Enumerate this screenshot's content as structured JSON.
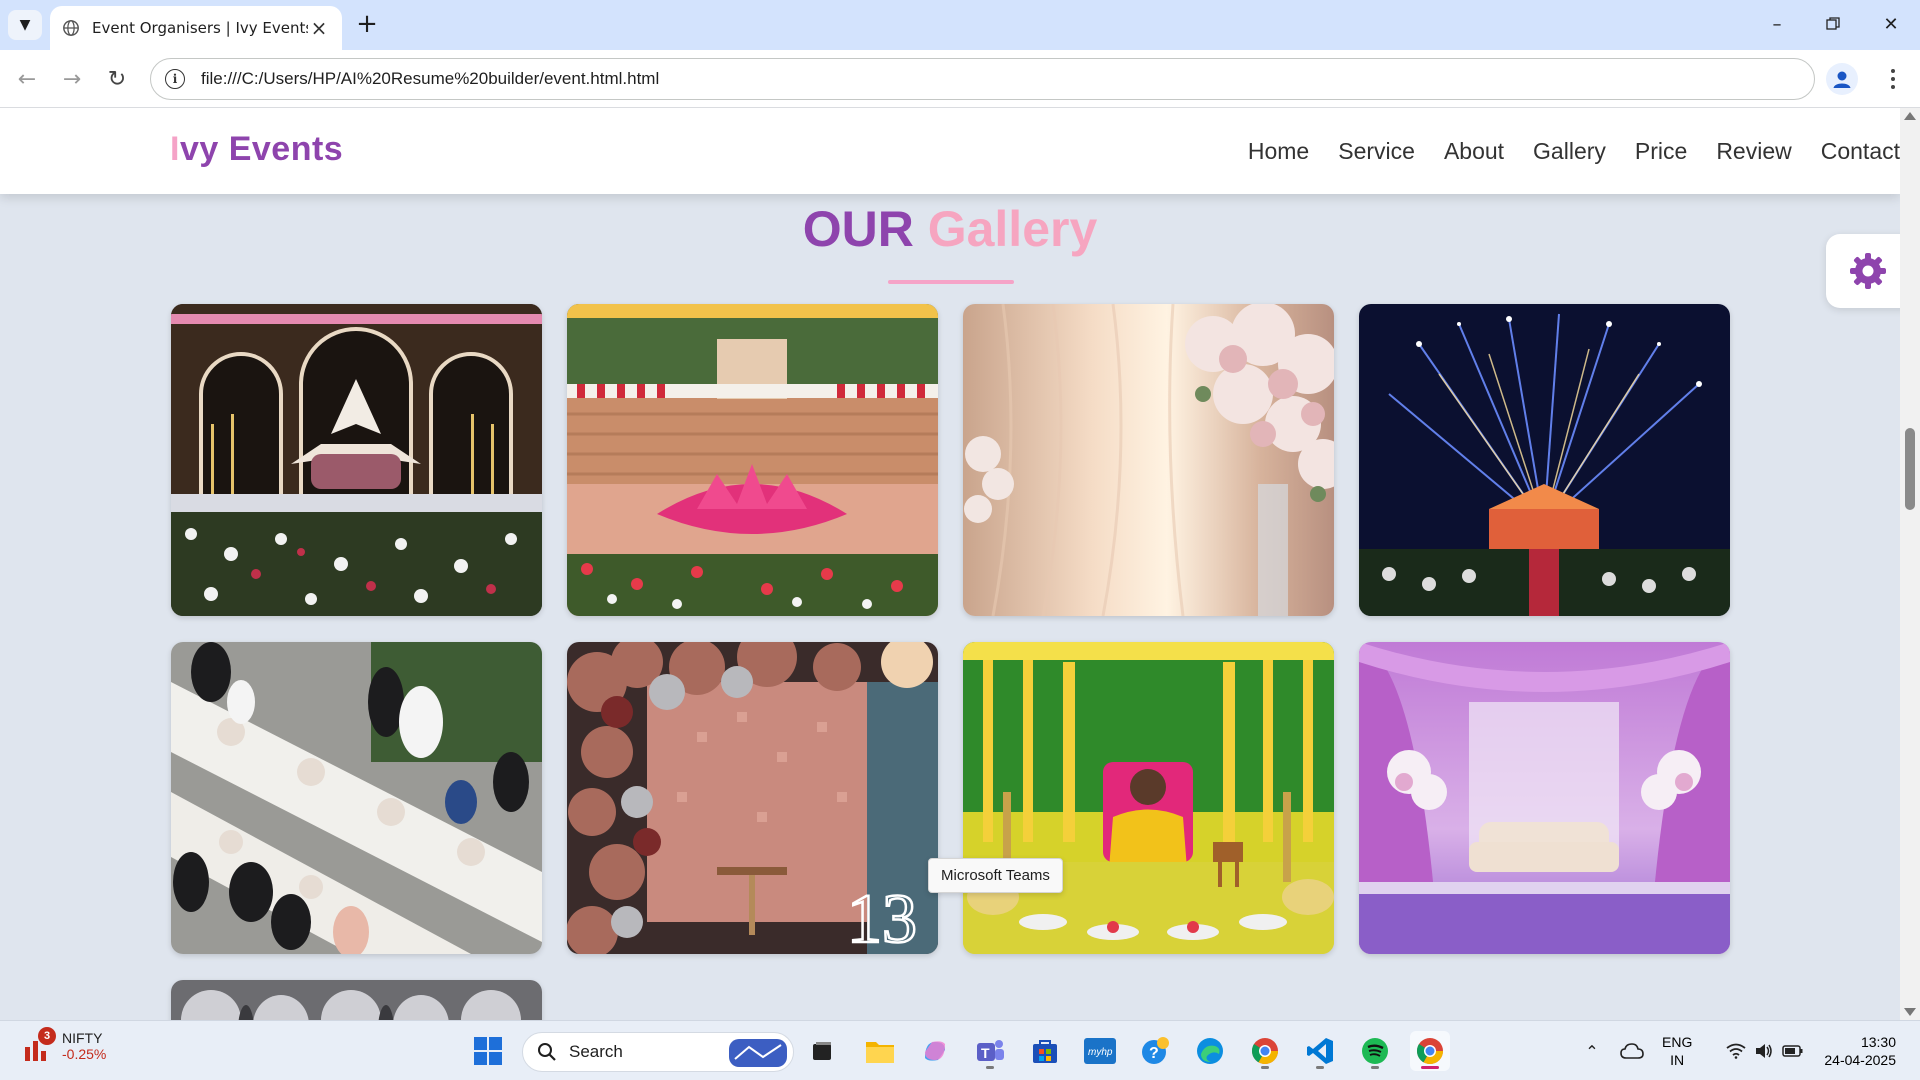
{
  "browser": {
    "tab_title": "Event Organisers | Ivy Events",
    "url": "file:///C:/Users/HP/AI%20Resume%20builder/event.html.html"
  },
  "site": {
    "logo_first": "I",
    "logo_rest": "vy Events",
    "nav": [
      "Home",
      "Service",
      "About",
      "Gallery",
      "Price",
      "Review",
      "Contact"
    ],
    "section_title_part1": "OUR",
    "section_title_part2": "Gallery",
    "gallery_images": [
      "stage-floral-decor",
      "lotus-stage-decor",
      "drape-flowers",
      "fireworks-venue",
      "wedding-dinner",
      "birthday-balloons",
      "haldi-ceremony",
      "purple-stage"
    ],
    "colors": {
      "primary": "#8e44ad",
      "accent": "#f5a3c7"
    }
  },
  "tooltip": "Microsoft Teams",
  "taskbar": {
    "widget_name": "NIFTY",
    "widget_change": "-0.25%",
    "widget_badge": "3",
    "search_label": "Search",
    "lang_line1": "ENG",
    "lang_line2": "IN",
    "time": "13:30",
    "date": "24-04-2025"
  }
}
